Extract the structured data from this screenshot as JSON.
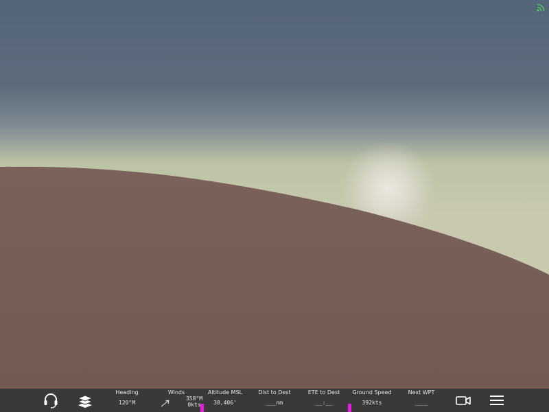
{
  "colors": {
    "sky_top": "#55657a",
    "sky_mid": "#7b8891",
    "horizon_glow": "#bcc3a6",
    "ground": "#755d56",
    "bar_bg": "#3a3939",
    "indicator": "#e91ee3",
    "signal_green": "#4fc95f"
  },
  "status": {
    "signal_icon": "signal-icon"
  },
  "toolbar": {
    "audio_icon": "headset-icon",
    "layers_icon": "layers-icon",
    "camera_icon": "camera-icon",
    "menu_icon": "menu-icon"
  },
  "stats": {
    "heading": {
      "label": "Heading",
      "value": "120°M"
    },
    "winds": {
      "label": "Winds",
      "direction": "358°M",
      "speed": "0kts"
    },
    "altitude": {
      "label": "Altitude MSL",
      "value": "38,406'"
    },
    "dist": {
      "label": "Dist to Dest",
      "value": "___nm"
    },
    "ete": {
      "label": "ETE to Dest",
      "value": "__:__"
    },
    "ground_speed": {
      "label": "Ground Speed",
      "value": "392kts"
    },
    "next_wpt": {
      "label": "Next WPT",
      "value": "____"
    }
  }
}
